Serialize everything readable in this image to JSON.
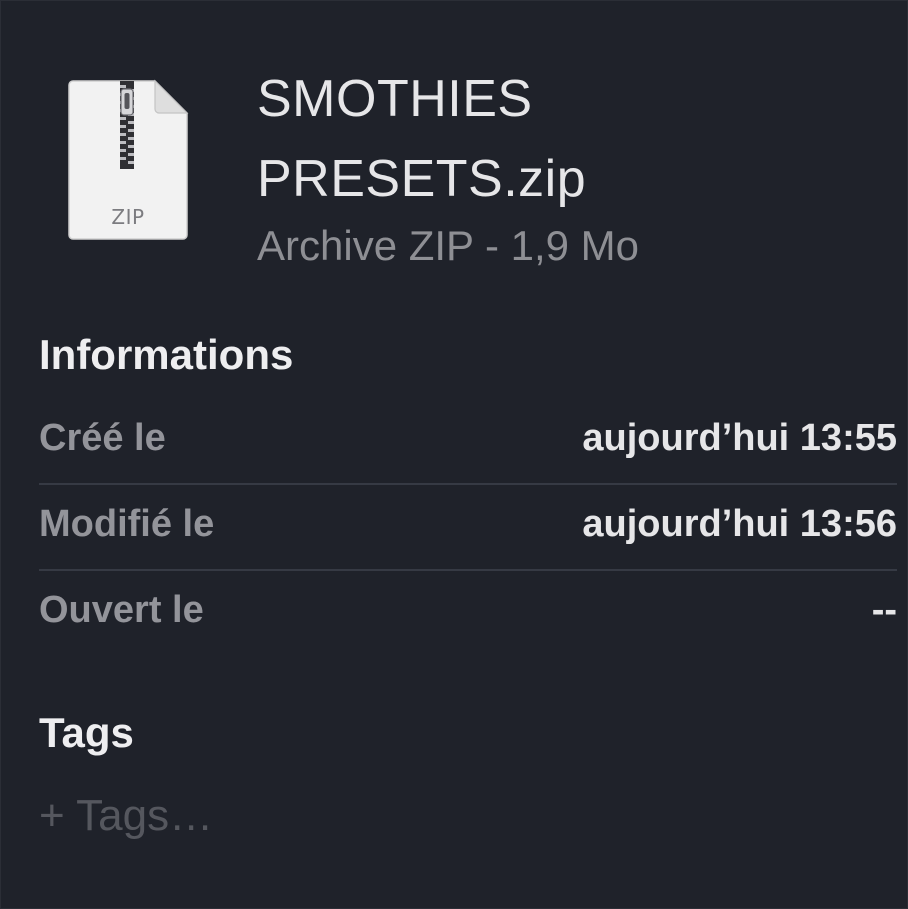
{
  "file": {
    "name": "SMOTHIES PRESETS.zip",
    "kind_and_size": "Archive ZIP - 1,9 Mo",
    "icon": "zip-archive-icon",
    "icon_label": "ZIP"
  },
  "informations": {
    "heading": "Informations",
    "rows": [
      {
        "label": "Créé le",
        "value": "aujourd’hui 13:55"
      },
      {
        "label": "Modifié le",
        "value": "aujourd’hui 13:56"
      },
      {
        "label": "Ouvert le",
        "value": "--"
      }
    ]
  },
  "tags": {
    "heading": "Tags",
    "placeholder": "+ Tags…"
  },
  "colors": {
    "background": "#1f222a",
    "primary_text": "#e6e6e8",
    "secondary_text": "#93949a",
    "divider": "#363a44",
    "placeholder_text": "#55575e"
  }
}
